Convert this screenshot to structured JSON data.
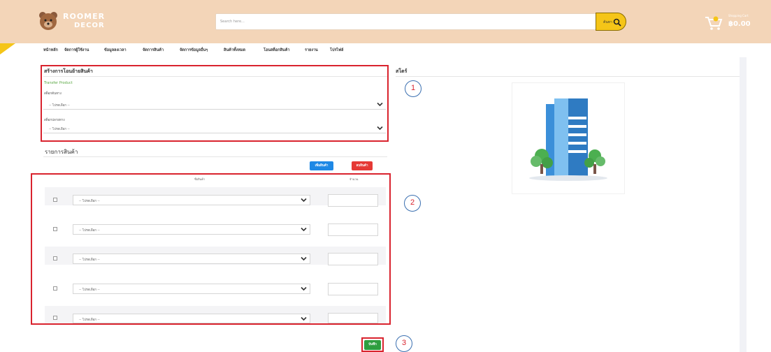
{
  "header": {
    "logo_top": "ROOMER",
    "logo_bottom": "DECOR",
    "search_placeholder": "Search here...",
    "search_button": "ค้นหา",
    "cart_label": "Shopping Cart",
    "cart_amount": "฿0.00"
  },
  "nav": {
    "items": [
      "หน้าหลัก",
      "จัดการผู้ใช้งาน",
      "ข้อมูลลงเวลา",
      "จัดการสินค้า",
      "จัดการข้อมูลอื่นๆ",
      "สินค้าทั้งหมด",
      "โอนสต็อกสินค้า",
      "รายงาน",
      "โปรไฟล์"
    ]
  },
  "transfer": {
    "title": "สร้างการโอนย้ายสินค้า",
    "subtitle": "Transfer Product",
    "source_label": "สต็อกต้นทาง",
    "source_value": "-- โปรดเลือก --",
    "dest_label": "สต็อกปลายทาง",
    "dest_value": "-- โปรดเลือก --"
  },
  "store": {
    "title": "สโตร์"
  },
  "products": {
    "title": "รายการสินค้า",
    "add_button": "เพิ่มสินค้า",
    "delete_button": "ลบสินค้า",
    "col_name": "ชื่อสินค้า",
    "col_qty": "จำนวน",
    "rows": [
      {
        "select": "-- โปรดเลือก --",
        "qty": ""
      },
      {
        "select": "-- โปรดเลือก --",
        "qty": ""
      },
      {
        "select": "-- โปรดเลือก --",
        "qty": ""
      },
      {
        "select": "-- โปรดเลือก --",
        "qty": ""
      },
      {
        "select": "-- โปรดเลือก --",
        "qty": ""
      }
    ]
  },
  "save_button": "บันทึก",
  "callouts": [
    "1",
    "2",
    "3"
  ],
  "colors": {
    "header_bg": "#f3d5b8",
    "accent_yellow": "#f5c518",
    "annotation_red": "#d9232e",
    "callout_blue": "#3a6fb0",
    "add_blue": "#1e88e5",
    "delete_red": "#e53935",
    "save_green": "#2e9e3f"
  }
}
